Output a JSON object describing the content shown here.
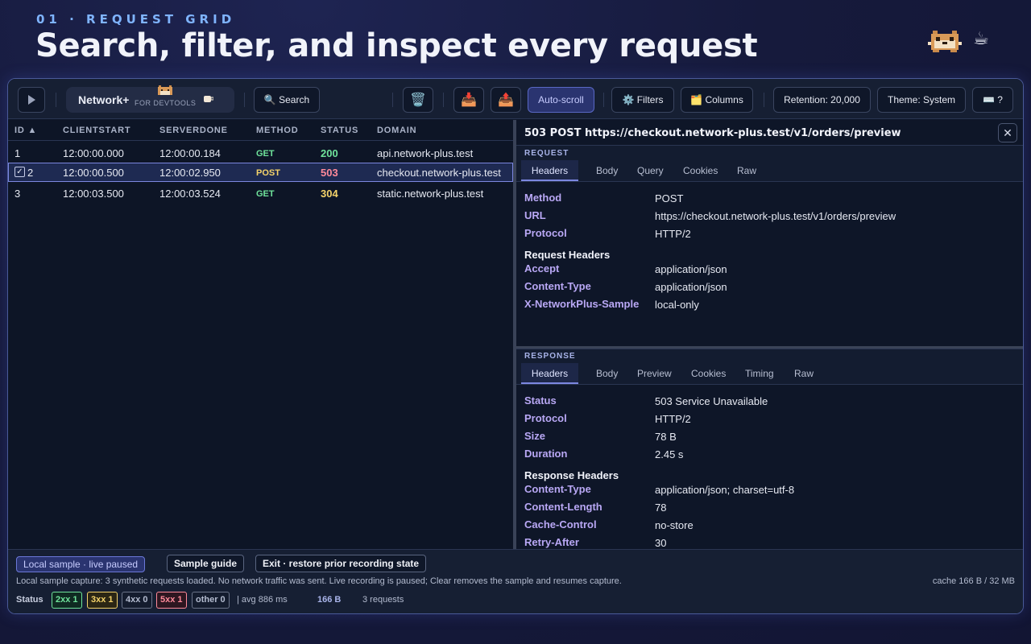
{
  "hero": {
    "eyebrow": "01 · REQUEST GRID",
    "title": "Search, filter, and inspect every request"
  },
  "toolbar": {
    "play_icon": "play-icon",
    "brand": {
      "name": "Network+",
      "sub": "FOR DEVTOOLS"
    },
    "search_label": "🔍 Search",
    "clear_icon": "🗑️",
    "import_icon": "📥",
    "export_icon": "📤",
    "autoscroll_label": "Auto-scroll",
    "filters_label": "⚙️ Filters",
    "columns_label": "🗂️ Columns",
    "retention_label": "Retention: 20,000",
    "theme_label": "Theme: System",
    "shortcuts_label": "⌨️ ?"
  },
  "grid": {
    "columns": [
      "ID ▲",
      "CLIENTSTART",
      "SERVERDONE",
      "METHOD",
      "STATUS",
      "DOMAIN"
    ],
    "rows": [
      {
        "id": "1",
        "clientstart": "12:00:00.000",
        "serverdone": "12:00:00.184",
        "method": "GET",
        "status": "200",
        "domain": "api.network-plus.test"
      },
      {
        "id": "2",
        "clientstart": "12:00:00.500",
        "serverdone": "12:00:02.950",
        "method": "POST",
        "status": "503",
        "domain": "checkout.network-plus.test",
        "checkbox": "✓"
      },
      {
        "id": "3",
        "clientstart": "12:00:03.500",
        "serverdone": "12:00:03.524",
        "method": "GET",
        "status": "304",
        "domain": "static.network-plus.test"
      }
    ]
  },
  "detail": {
    "title": "503 POST https://checkout.network-plus.test/v1/orders/preview",
    "close": "✕",
    "request": {
      "label": "REQUEST",
      "tabs": [
        "Headers",
        "Body",
        "Query",
        "Cookies",
        "Raw"
      ],
      "fields": [
        {
          "k": "Method",
          "v": "POST"
        },
        {
          "k": "URL",
          "v": "https://checkout.network-plus.test/v1/orders/preview"
        },
        {
          "k": "Protocol",
          "v": "HTTP/2"
        }
      ],
      "headers_title": "Request Headers",
      "headers": [
        {
          "k": "Accept",
          "v": "application/json"
        },
        {
          "k": "Content-Type",
          "v": "application/json"
        },
        {
          "k": "X-NetworkPlus-Sample",
          "v": "local-only"
        }
      ]
    },
    "response": {
      "label": "RESPONSE",
      "tabs": [
        "Headers",
        "Body",
        "Preview",
        "Cookies",
        "Timing",
        "Raw"
      ],
      "fields": [
        {
          "k": "Status",
          "v": "503 Service Unavailable"
        },
        {
          "k": "Protocol",
          "v": "HTTP/2"
        },
        {
          "k": "Size",
          "v": "78 B"
        },
        {
          "k": "Duration",
          "v": "2.45 s"
        }
      ],
      "headers_title": "Response Headers",
      "headers": [
        {
          "k": "Content-Type",
          "v": "application/json; charset=utf-8"
        },
        {
          "k": "Content-Length",
          "v": "78"
        },
        {
          "k": "Cache-Control",
          "v": "no-store"
        },
        {
          "k": "Retry-After",
          "v": "30"
        }
      ]
    }
  },
  "footer": {
    "note_pill": "Local sample · live paused",
    "guide_button": "Sample guide",
    "exit_button": "Exit · restore prior recording state",
    "message": "Local sample capture: 3 synthetic requests loaded. No network traffic was sent. Live recording is paused; Clear removes the sample and resumes capture.",
    "cache": "cache 166 B / 32 MB",
    "status_label": "Status",
    "chips": [
      "2xx 1",
      "3xx 1",
      "4xx 0",
      "5xx 1",
      "other 0"
    ],
    "avg": "| avg 886 ms",
    "total_size": "166 B",
    "count": "3 requests"
  },
  "colors": {
    "accent": "#7c87e0",
    "get": "#6fe39b",
    "post": "#f5d36a",
    "error": "#ff8a9a"
  }
}
